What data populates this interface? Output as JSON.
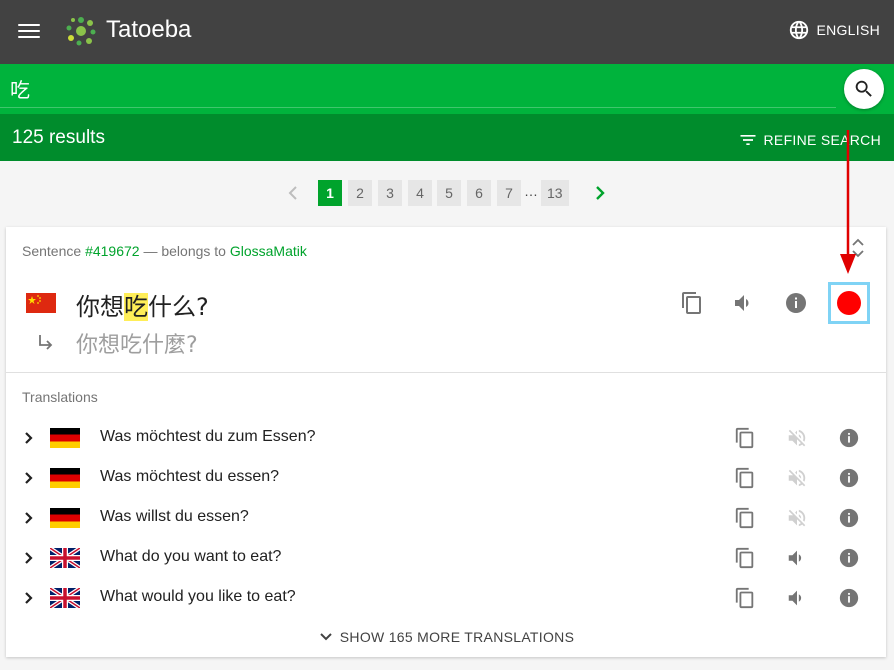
{
  "app": {
    "brand": "Tatoeba",
    "language_label": "ENGLISH"
  },
  "search": {
    "query": "吃",
    "placeholder": ""
  },
  "results": {
    "count_label": "125 results",
    "refine_label": "REFINE SEARCH"
  },
  "pagination": {
    "pages": [
      "1",
      "2",
      "3",
      "4",
      "5",
      "6",
      "7",
      "13"
    ],
    "ellipsis": "…",
    "current": "1"
  },
  "sentence": {
    "meta_prefix": "Sentence ",
    "id_label": "#419672",
    "meta_middle": " — belongs to ",
    "owner": "GlossaMatik",
    "text_before": "你想",
    "text_highlight": "吃",
    "text_after": "什么?",
    "transcription": "你想吃什麼?",
    "language_flag": "china-flag"
  },
  "translations": {
    "label": "Translations",
    "items": [
      {
        "text": "Was möchtest du zum Essen?",
        "flag": "germany-flag",
        "audio": false
      },
      {
        "text": "Was möchtest du essen?",
        "flag": "germany-flag",
        "audio": false
      },
      {
        "text": "Was willst du essen?",
        "flag": "germany-flag",
        "audio": false
      },
      {
        "text": "What do you want to eat?",
        "flag": "uk-flag",
        "audio": true
      },
      {
        "text": "What would you like to eat?",
        "flag": "uk-flag",
        "audio": true
      }
    ],
    "show_more_label": "SHOW 165 MORE TRANSLATIONS"
  },
  "colors": {
    "topbar": "#424242",
    "search_green": "#00b33c",
    "results_green": "#008c2c",
    "active_page": "#00a32c",
    "highlight": "#ffee58",
    "record": "#ff0000",
    "annotation_box": "#7fd3f5",
    "annotation_arrow": "#e00000"
  }
}
